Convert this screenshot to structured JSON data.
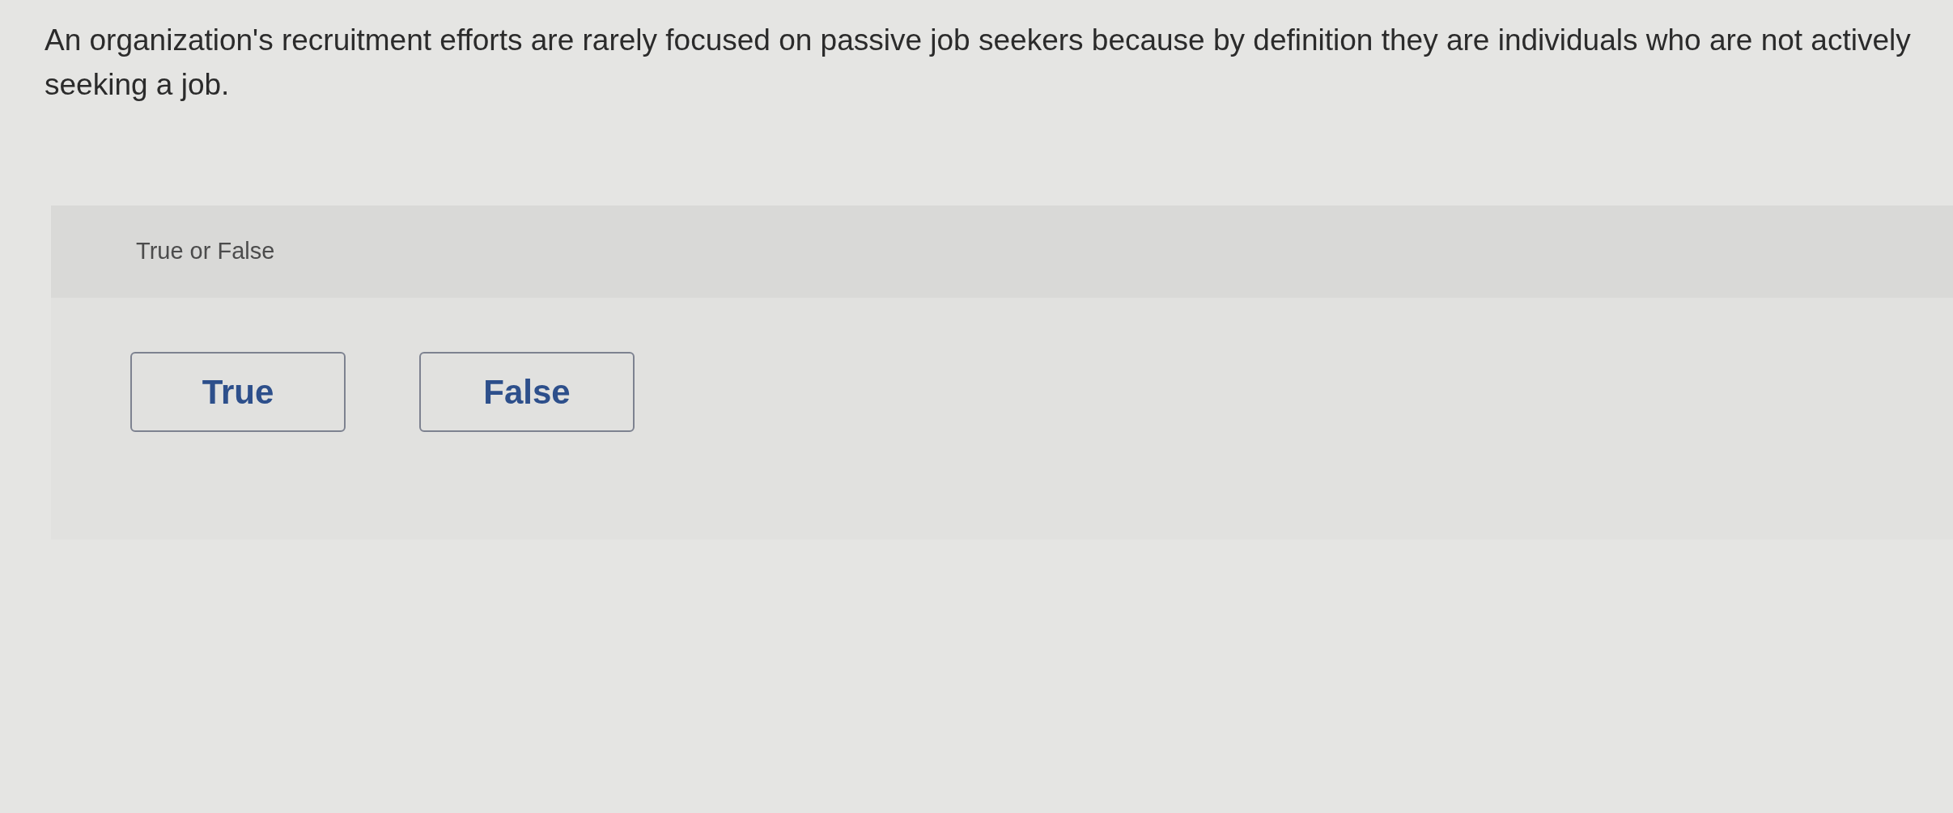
{
  "question": {
    "text": "An organization's recruitment efforts are rarely focused on passive job seekers because by definition they are individuals who are not actively seeking a job."
  },
  "answer_panel": {
    "prompt": "True or False",
    "options": [
      {
        "label": "True",
        "selected": false
      },
      {
        "label": "False",
        "selected": false
      }
    ]
  }
}
